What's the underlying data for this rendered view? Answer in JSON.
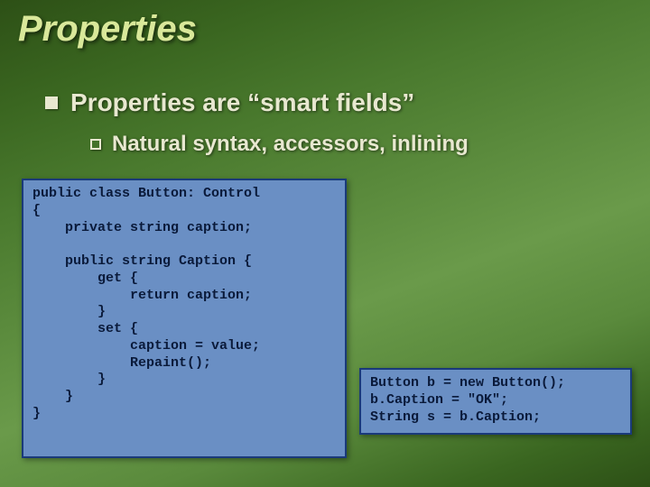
{
  "title": "Properties",
  "bullets": {
    "l1": "Properties are “smart fields”",
    "l2": "Natural syntax, accessors, inlining"
  },
  "code": {
    "left": "public class Button: Control\n{\n    private string caption;\n\n    public string Caption {\n        get {\n            return caption;\n        }\n        set {\n            caption = value;\n            Repaint();\n        }\n    }\n}",
    "right": "Button b = new Button();\nb.Caption = \"OK\";\nString s = b.Caption;"
  }
}
